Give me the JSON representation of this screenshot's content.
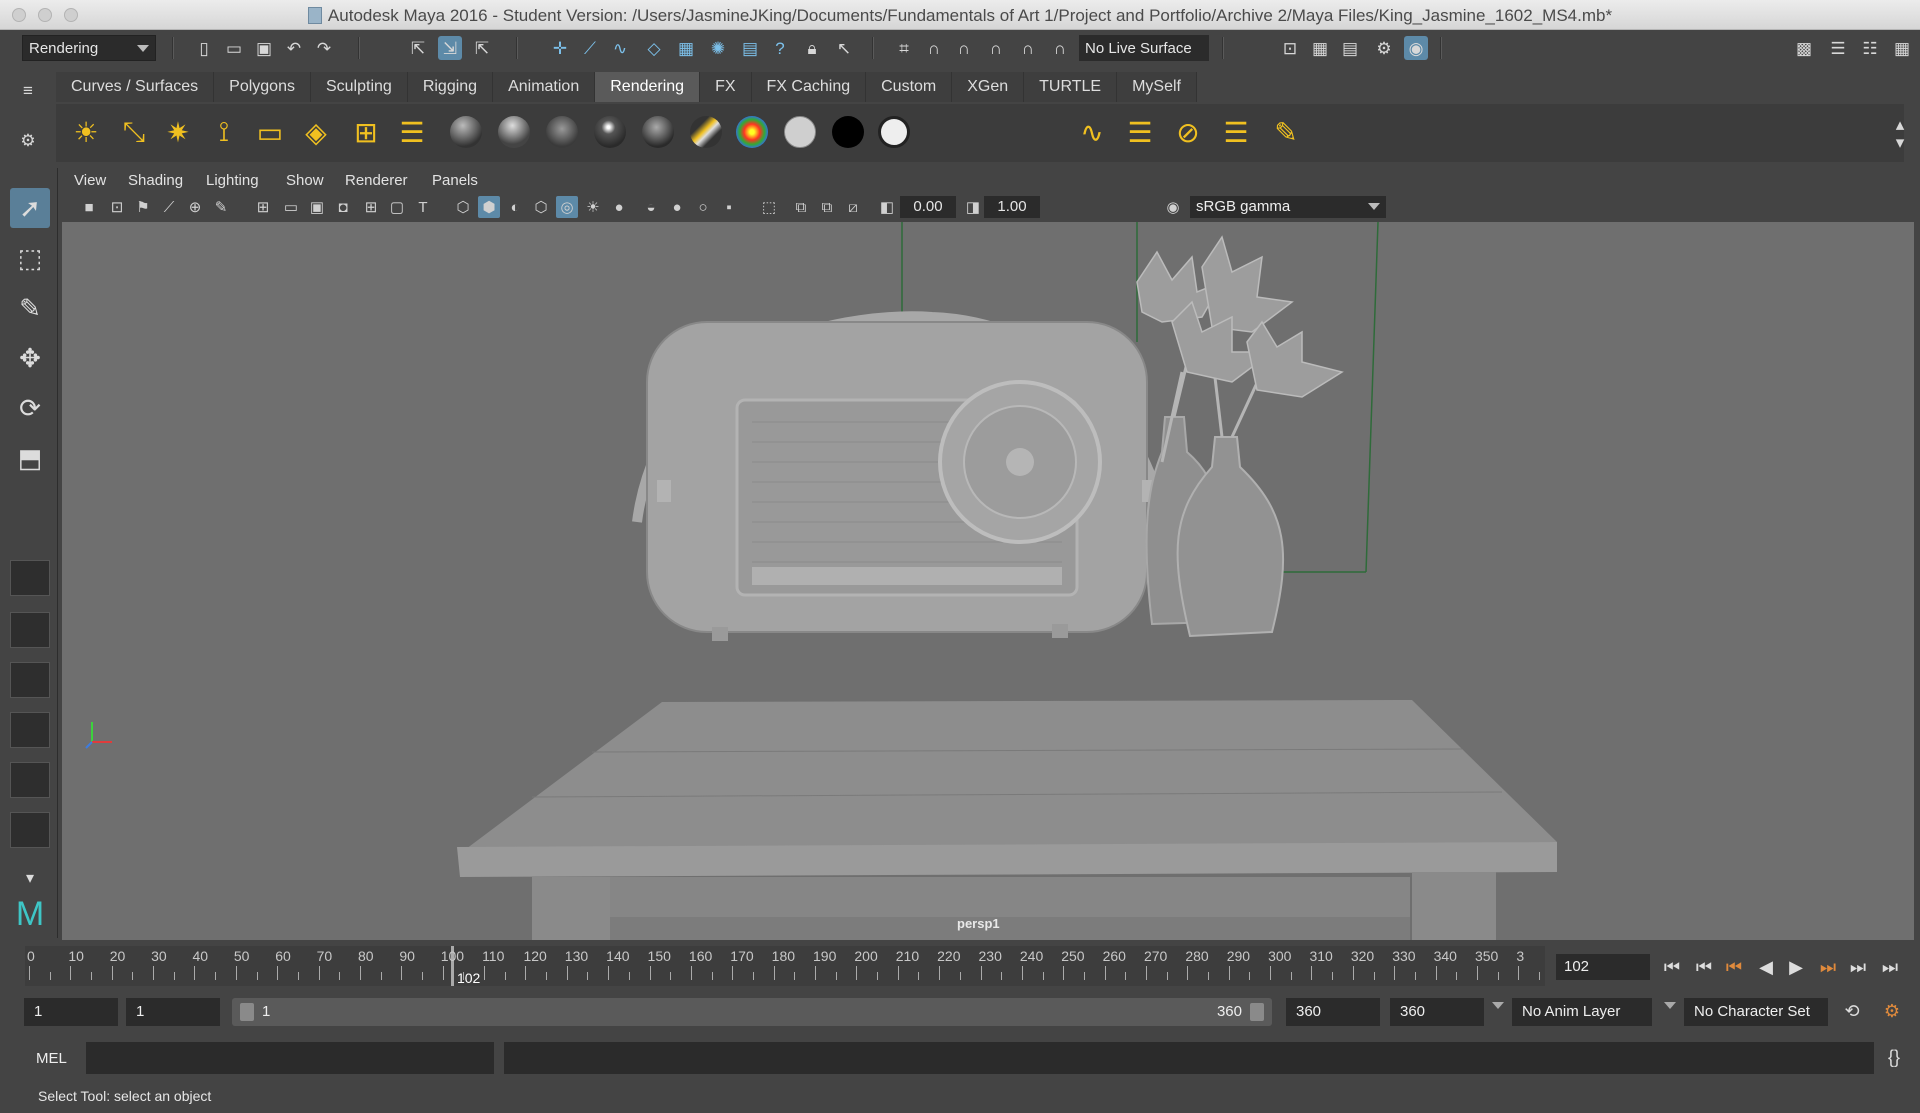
{
  "window": {
    "title": "Autodesk Maya 2016 - Student Version: /Users/JasmineJKing/Documents/Fundamentals of Art 1/Project and Portfolio/Archive 2/Maya Files/King_Jasmine_1602_MS4.mb*"
  },
  "statusline": {
    "menuset": "Rendering",
    "live_surface": "No Live Surface"
  },
  "shelf": {
    "tabs": [
      "Curves / Surfaces",
      "Polygons",
      "Sculpting",
      "Rigging",
      "Animation",
      "Rendering",
      "FX",
      "FX Caching",
      "Custom",
      "XGen",
      "TURTLE",
      "MySelf"
    ],
    "active_tab": "Rendering"
  },
  "panel": {
    "menus": [
      "View",
      "Shading",
      "Lighting",
      "Show",
      "Renderer",
      "Panels"
    ],
    "exposure": "0.00",
    "gamma": "1.00",
    "color_space": "sRGB gamma",
    "camera": "persp1"
  },
  "timeline": {
    "ticks": [
      "0",
      "10",
      "20",
      "30",
      "40",
      "50",
      "60",
      "70",
      "80",
      "90",
      "100",
      "110",
      "120",
      "130",
      "140",
      "150",
      "160",
      "170",
      "180",
      "190",
      "200",
      "210",
      "220",
      "230",
      "240",
      "250",
      "260",
      "270",
      "280",
      "290",
      "300",
      "310",
      "320",
      "330",
      "340",
      "350",
      "3"
    ],
    "current_frame": "102",
    "current_frame_field": "102"
  },
  "range": {
    "start": "1",
    "playback_start": "1",
    "range_start": "1",
    "range_end": "360",
    "playback_end": "360",
    "end": "360",
    "anim_layer": "No Anim Layer",
    "character_set": "No Character Set"
  },
  "command": {
    "label": "MEL"
  },
  "helpline": {
    "text": "Select Tool: select an object"
  },
  "colors": {
    "accent": "#5d8aa8",
    "shelf_icon": "#f0c020",
    "viewport_bg": "#6f6f6f"
  }
}
